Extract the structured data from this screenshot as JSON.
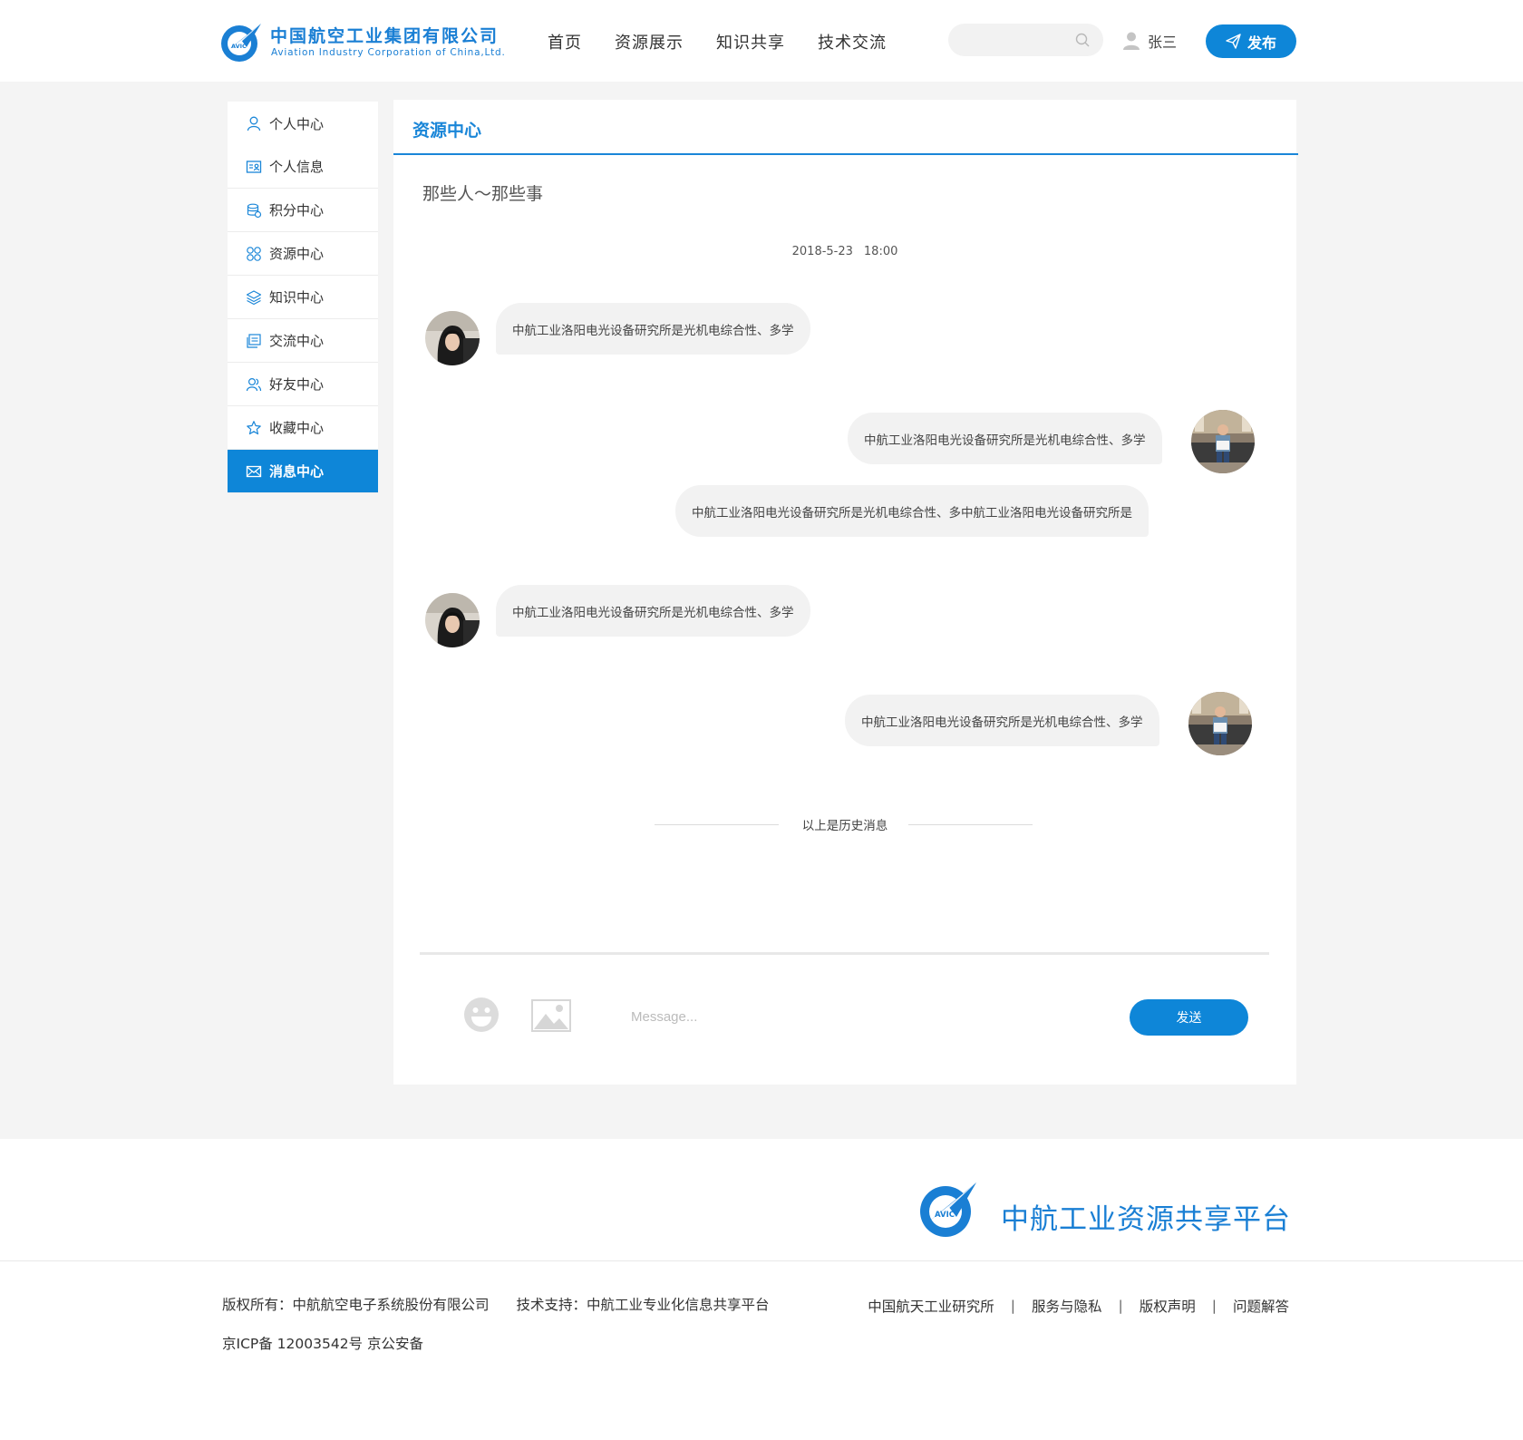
{
  "header": {
    "logo_cn": "中国航空工业集团有限公司",
    "logo_en": "Aviation Industry Corporation of China,Ltd.",
    "logo_badge": "AVIC",
    "nav": [
      "首页",
      "资源展示",
      "知识共享",
      "技术交流"
    ],
    "search_placeholder": "",
    "username": "张三",
    "publish_label": "发布",
    "accent_color": "#0e86d8"
  },
  "sidebar": {
    "items": [
      {
        "label": "个人中心",
        "icon": "person-icon"
      },
      {
        "label": "个人信息",
        "icon": "id-card-icon"
      },
      {
        "label": "积分中心",
        "icon": "coins-icon"
      },
      {
        "label": "资源中心",
        "icon": "grid-circles-icon"
      },
      {
        "label": "知识中心",
        "icon": "layers-icon"
      },
      {
        "label": "交流中心",
        "icon": "chat-list-icon"
      },
      {
        "label": "好友中心",
        "icon": "friends-icon"
      },
      {
        "label": "收藏中心",
        "icon": "star-icon"
      },
      {
        "label": "消息中心",
        "icon": "envelope-icon",
        "active": true
      }
    ]
  },
  "panel": {
    "title": "资源中心",
    "chat_title": "那些人～那些事",
    "date": "2018-5-23",
    "time": "18:00",
    "messages": [
      {
        "side": "left",
        "text": "中航工业洛阳电光设备研究所是光机电综合性、多学"
      },
      {
        "side": "right",
        "text": "中航工业洛阳电光设备研究所是光机电综合性、多学"
      },
      {
        "side": "right",
        "text": "中航工业洛阳电光设备研究所是光机电综合性、多中航工业洛阳电光设备研究所是"
      },
      {
        "side": "left",
        "text": "中航工业洛阳电光设备研究所是光机电综合性、多学"
      },
      {
        "side": "right",
        "text": "中航工业洛阳电光设备研究所是光机电综合性、多学"
      }
    ],
    "history_label": "以上是历史消息",
    "message_placeholder": "Message...",
    "send_label": "发送"
  },
  "footer": {
    "brand_name": "中航工业资源共享平台",
    "brand_badge": "AVIC",
    "copyright": "版权所有：中航航空电子系统股份有限公司",
    "support": "技术支持：中航工业专业化信息共享平台",
    "icp": "京ICP备 12003542号 京公安备",
    "links": [
      "中国航天工业研究所",
      "服务与隐私",
      "版权声明",
      "问题解答"
    ]
  }
}
